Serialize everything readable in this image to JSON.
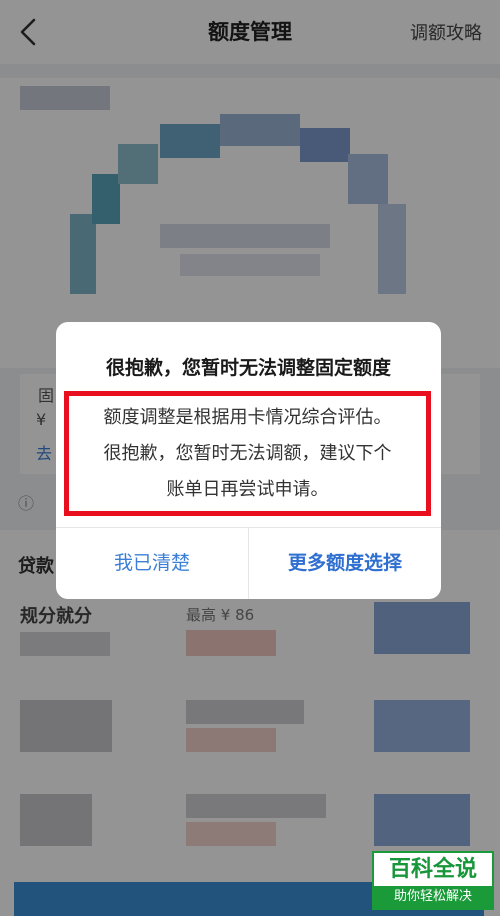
{
  "header": {
    "title": "额度管理",
    "right_link": "调额攻略"
  },
  "dialog": {
    "title": "很抱歉，您暂时无法调整固定额度",
    "message_lines": [
      "额度调整是根据用卡情况综合评估。",
      "很抱歉，您暂时无法调额，建议下个",
      "账单日再尝试申请。"
    ],
    "secondary_button": "我已清楚",
    "primary_button": "更多额度选择"
  },
  "background_visible_fragments": {
    "fixed_limit_label": "固",
    "yen": "¥",
    "link": "去",
    "info": "ⓘ",
    "loan_section": "贷款",
    "row_label": "规分就分",
    "row_hint": "最高 ¥ 86"
  },
  "watermark": {
    "top": "百科全说",
    "bottom": "助你轻松解决"
  },
  "colors": {
    "alert_border": "#e8101f",
    "button_blue": "#2f6fd0",
    "watermark_green": "#1b9a3a"
  }
}
